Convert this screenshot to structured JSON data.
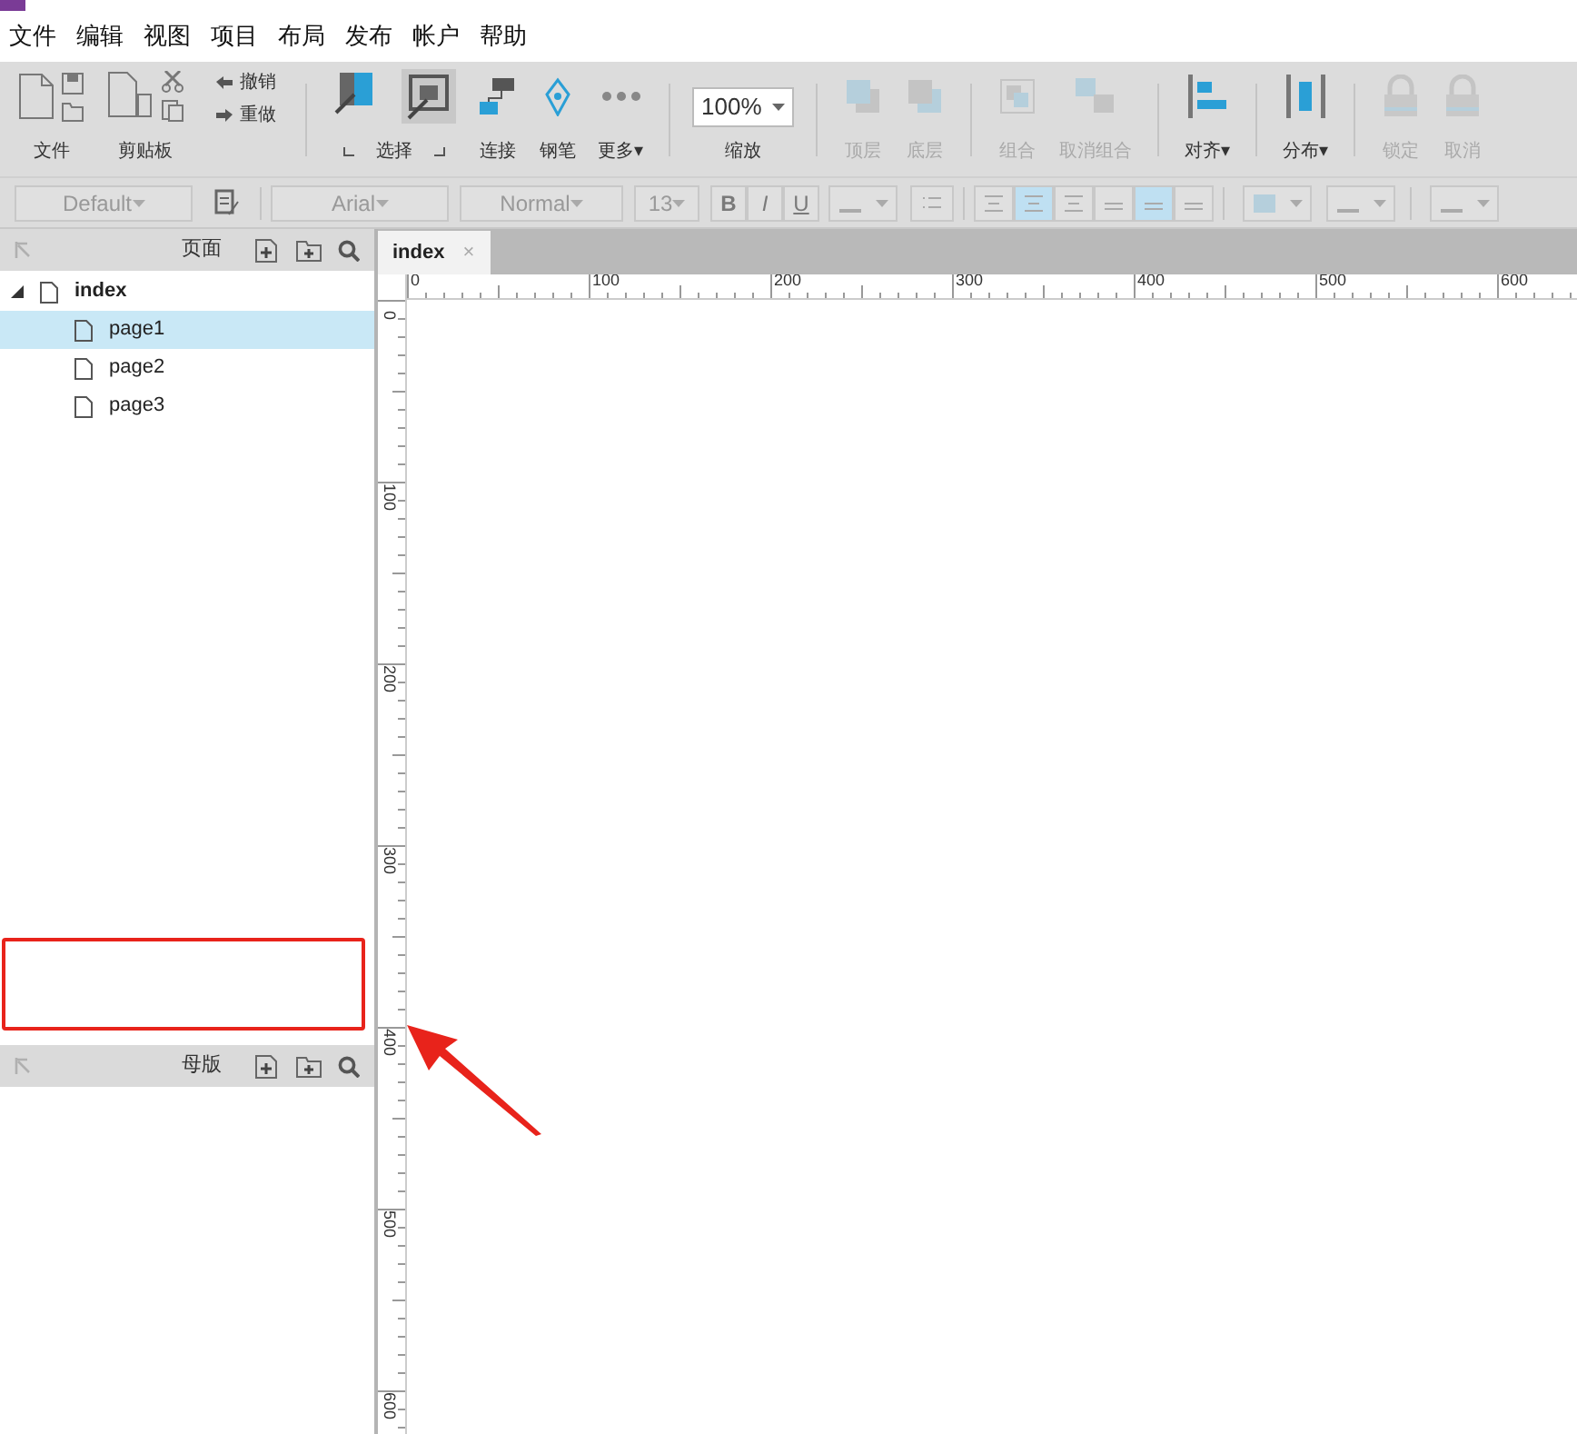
{
  "menu": [
    "文件",
    "编辑",
    "视图",
    "项目",
    "布局",
    "发布",
    "帐户",
    "帮助"
  ],
  "toolbar": [
    {
      "kind": "file",
      "label": "文件",
      "disabled": false
    },
    {
      "kind": "clipboard",
      "label": "剪贴板",
      "disabled": false
    },
    {
      "kind": "history",
      "undo": "撤销",
      "redo": "重做",
      "disabled": false
    },
    {
      "kind": "divider"
    },
    {
      "kind": "select",
      "label": "选择",
      "disabled": false
    },
    {
      "kind": "connect",
      "label": "连接",
      "disabled": false
    },
    {
      "kind": "pen",
      "label": "钢笔",
      "disabled": false
    },
    {
      "kind": "more",
      "label": "更多▾",
      "disabled": false
    },
    {
      "kind": "divider"
    },
    {
      "kind": "zoom",
      "value": "100%",
      "label": "缩放",
      "disabled": false
    },
    {
      "kind": "divider"
    },
    {
      "kind": "front",
      "label": "顶层",
      "disabled": true
    },
    {
      "kind": "back",
      "label": "底层",
      "disabled": true
    },
    {
      "kind": "divider"
    },
    {
      "kind": "group",
      "label": "组合",
      "disabled": true
    },
    {
      "kind": "ungroup",
      "label": "取消组合",
      "disabled": true
    },
    {
      "kind": "divider"
    },
    {
      "kind": "align",
      "label": "对齐▾",
      "disabled": false
    },
    {
      "kind": "divider"
    },
    {
      "kind": "distribute",
      "label": "分布▾",
      "disabled": false
    },
    {
      "kind": "divider"
    },
    {
      "kind": "lock",
      "label": "锁定",
      "disabled": true
    },
    {
      "kind": "unlock",
      "label": "取消",
      "disabled": true
    }
  ],
  "format_bar": [
    {
      "kind": "style_select",
      "value": "Default"
    },
    {
      "kind": "paint"
    },
    {
      "kind": "divider"
    },
    {
      "kind": "font_select",
      "value": "Arial"
    },
    {
      "kind": "weight_select",
      "value": "Normal"
    },
    {
      "kind": "size_select",
      "value": "13"
    },
    {
      "kind": "bold",
      "label": "B"
    },
    {
      "kind": "italic",
      "label": "I"
    },
    {
      "kind": "underline",
      "label": "U"
    },
    {
      "kind": "color"
    },
    {
      "kind": "bullets"
    },
    {
      "kind": "divider"
    },
    {
      "kind": "halign",
      "selected": false
    },
    {
      "kind": "halign",
      "selected": true
    },
    {
      "kind": "halign",
      "selected": false
    },
    {
      "kind": "valign",
      "selected": false
    },
    {
      "kind": "valign",
      "selected": true
    },
    {
      "kind": "valign",
      "selected": false
    },
    {
      "kind": "divider"
    },
    {
      "kind": "fill"
    },
    {
      "kind": "shadow"
    },
    {
      "kind": "divider"
    },
    {
      "kind": "line"
    }
  ],
  "pages_panel": {
    "title": "页面",
    "tree": [
      {
        "label": "index",
        "expanded": true,
        "selected": false,
        "children": [
          {
            "label": "page1",
            "selected": true
          },
          {
            "label": "page2",
            "selected": false
          },
          {
            "label": "page3",
            "selected": false
          }
        ]
      }
    ]
  },
  "masters_panel": {
    "title": "母版"
  },
  "tabs": [
    {
      "label": "index",
      "close": "×",
      "selected": true
    }
  ],
  "ruler_h": [
    "0",
    "100",
    "200",
    "300",
    "400",
    "500",
    "600"
  ],
  "ruler_v": [
    "0",
    "100",
    "200",
    "300",
    "400",
    "500",
    "600"
  ]
}
